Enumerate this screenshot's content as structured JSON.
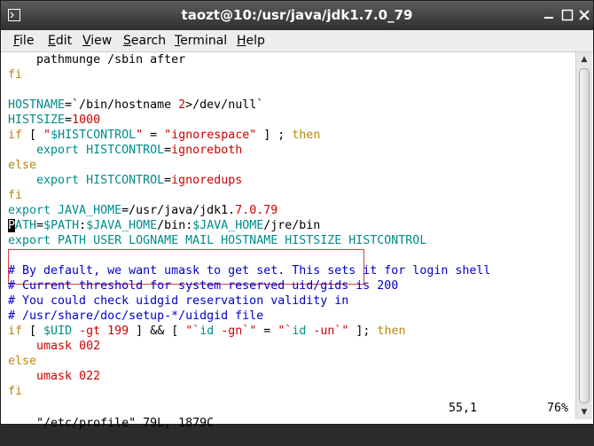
{
  "window": {
    "title": "taozt@10:/usr/java/jdk1.7.0_79"
  },
  "menubar": {
    "items": [
      {
        "underline": "F",
        "rest": "ile"
      },
      {
        "underline": "E",
        "rest": "dit"
      },
      {
        "underline": "V",
        "rest": "iew"
      },
      {
        "underline": "S",
        "rest": "earch"
      },
      {
        "underline": "T",
        "rest": "erminal"
      },
      {
        "underline": "H",
        "rest": "elp"
      }
    ]
  },
  "editor": {
    "lines": [
      [
        [
          "pl",
          "    pathmunge /sbin after"
        ]
      ],
      [
        [
          "kw",
          "fi"
        ]
      ],
      [
        [
          "pl",
          ""
        ]
      ],
      [
        [
          "id",
          "HOSTNAME"
        ],
        [
          "pl",
          "=`/bin/hostname "
        ],
        [
          "num",
          "2"
        ],
        [
          "pl",
          ">/dev/null`"
        ]
      ],
      [
        [
          "id",
          "HISTSIZE"
        ],
        [
          "pl",
          "="
        ],
        [
          "num",
          "1000"
        ]
      ],
      [
        [
          "kw",
          "if"
        ],
        [
          "pl",
          " [ "
        ],
        [
          "str",
          "\""
        ],
        [
          "id",
          "$HISTCONTROL"
        ],
        [
          "str",
          "\""
        ],
        [
          "pl",
          " = "
        ],
        [
          "str",
          "\"ignorespace\""
        ],
        [
          "pl",
          " ] ; "
        ],
        [
          "kw",
          "then"
        ]
      ],
      [
        [
          "pl",
          "    "
        ],
        [
          "id",
          "export HISTCONTROL"
        ],
        [
          "pl",
          "="
        ],
        [
          "str",
          "ignoreboth"
        ]
      ],
      [
        [
          "kw",
          "else"
        ]
      ],
      [
        [
          "pl",
          "    "
        ],
        [
          "id",
          "export HISTCONTROL"
        ],
        [
          "pl",
          "="
        ],
        [
          "str",
          "ignoredups"
        ]
      ],
      [
        [
          "kw",
          "fi"
        ]
      ],
      [
        [
          "id",
          "export JAVA_HOME"
        ],
        [
          "pl",
          "=/usr/java/jdk1."
        ],
        [
          "num",
          "7.0.79"
        ]
      ],
      [
        [
          "cur",
          "P"
        ],
        [
          "id",
          "ATH"
        ],
        [
          "pl",
          "="
        ],
        [
          "id",
          "$PATH"
        ],
        [
          "pl",
          ":"
        ],
        [
          "id",
          "$JAVA_HOME"
        ],
        [
          "pl",
          "/bin:"
        ],
        [
          "id",
          "$JAVA_HOME"
        ],
        [
          "pl",
          "/jre/bin"
        ]
      ],
      [
        [
          "id",
          "export PATH USER LOGNAME MAIL HOSTNAME HISTSIZE HISTCONTROL"
        ]
      ],
      [
        [
          "pl",
          ""
        ]
      ],
      [
        [
          "cm",
          "# By default, we want umask to get set. This sets it for login shell"
        ]
      ],
      [
        [
          "cm",
          "# Current threshold for system reserved uid/gids is 200"
        ]
      ],
      [
        [
          "cm",
          "# You could check uidgid reservation validity in"
        ]
      ],
      [
        [
          "cm",
          "# /usr/share/doc/setup-*/uidgid file"
        ]
      ],
      [
        [
          "kw",
          "if"
        ],
        [
          "pl",
          " [ "
        ],
        [
          "id",
          "$UID"
        ],
        [
          "pl",
          " "
        ],
        [
          "str",
          "-gt"
        ],
        [
          "pl",
          " "
        ],
        [
          "num",
          "199"
        ],
        [
          "pl",
          " ] && [ "
        ],
        [
          "str",
          "\"`"
        ],
        [
          "id",
          "id"
        ],
        [
          "pl",
          " "
        ],
        [
          "str",
          "-gn`\""
        ],
        [
          "pl",
          " = "
        ],
        [
          "str",
          "\"`"
        ],
        [
          "id",
          "id"
        ],
        [
          "pl",
          " "
        ],
        [
          "str",
          "-un`\""
        ],
        [
          "pl",
          " ]; "
        ],
        [
          "kw",
          "then"
        ]
      ],
      [
        [
          "pl",
          "    "
        ],
        [
          "str",
          "umask"
        ],
        [
          "pl",
          " "
        ],
        [
          "num",
          "002"
        ]
      ],
      [
        [
          "kw",
          "else"
        ]
      ],
      [
        [
          "pl",
          "    "
        ],
        [
          "str",
          "umask"
        ],
        [
          "pl",
          " "
        ],
        [
          "num",
          "022"
        ]
      ],
      [
        [
          "kw",
          "fi"
        ]
      ]
    ]
  },
  "status": {
    "file": "\"/etc/profile\" 79L, 1879C",
    "position": "55,1",
    "percent": "76%"
  },
  "colors": {
    "identifier": "#008b8b",
    "keyword": "#b8860b",
    "string": "#cc0000",
    "comment": "#0000cc",
    "highlight_box": "#d04040"
  }
}
